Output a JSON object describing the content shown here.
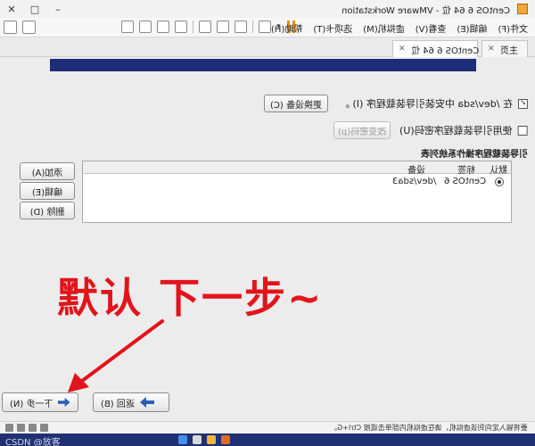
{
  "window": {
    "title": "CentOS 6 64 位 - VMware Workstation",
    "controls": [
      "✕",
      "□",
      "–"
    ]
  },
  "menu": {
    "items": [
      "文件(F)",
      "编辑(E)",
      "查看(V)",
      "虚拟机(M)",
      "选项卡(T)",
      "帮助(H)"
    ]
  },
  "tabs": {
    "home": "主页",
    "vm": "CentOS 6 64 位"
  },
  "installer": {
    "install_bootloader_label": "在 /dev/sda 中安装引导装载程序 (I) 。",
    "install_bootloader_checked": "✓",
    "change_device_label": "更换设备 (C)",
    "use_password_label": "使用引导装载程序密码(U)",
    "change_password_label": "改变密码(p)",
    "os_list_title": "引导装载程序操作系统列表",
    "columns": {
      "default": "默认",
      "label": "标签",
      "device": "设备"
    },
    "rows": [
      {
        "label": "CentOS 6",
        "device": "/dev/sda3"
      }
    ],
    "add_label": "添加(A)",
    "edit_label": "编辑(E)",
    "delete_label": "删除 (D)",
    "annotation": "默认 下一步~",
    "back_label": "返回 (B)",
    "next_label": "下一步 (N)"
  },
  "status": {
    "hint": "要将输入定向到该虚拟机，请在虚拟机内部单击或按 Ctrl+G。"
  },
  "taskbar": {
    "watermark": "CSDN @放客"
  },
  "colors": {
    "annotation": "#e2141b",
    "banner": "#1d2d78",
    "taskbar": "#1f3172"
  }
}
